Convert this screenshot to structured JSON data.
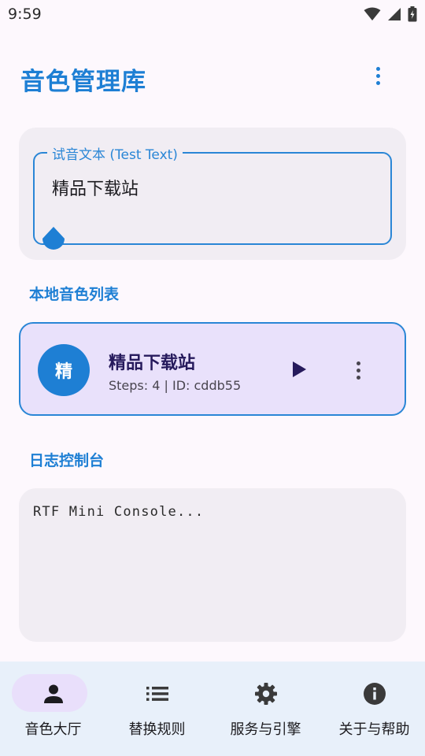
{
  "status_bar": {
    "time": "9:59"
  },
  "app": {
    "title": "音色管理库"
  },
  "test_text": {
    "label": "试音文本 (Test Text)",
    "value": "精品下载站"
  },
  "sections": {
    "local_voices": "本地音色列表",
    "log_console": "日志控制台"
  },
  "voices": [
    {
      "avatar_letter": "精",
      "name": "精品下载站",
      "meta": "Steps: 4 | ID: cddb55"
    }
  ],
  "console": {
    "text": "RTF Mini Console..."
  },
  "bottom_nav": {
    "items": [
      {
        "label": "音色大厅",
        "icon": "person-icon",
        "selected": true
      },
      {
        "label": "替换规则",
        "icon": "list-icon",
        "selected": false
      },
      {
        "label": "服务与引擎",
        "icon": "gear-icon",
        "selected": false
      },
      {
        "label": "关于与帮助",
        "icon": "info-icon",
        "selected": false
      }
    ]
  },
  "colors": {
    "accent": "#1e7fd4",
    "card_selected": "#e9e1fb",
    "nav_background": "#e8f0fa"
  }
}
